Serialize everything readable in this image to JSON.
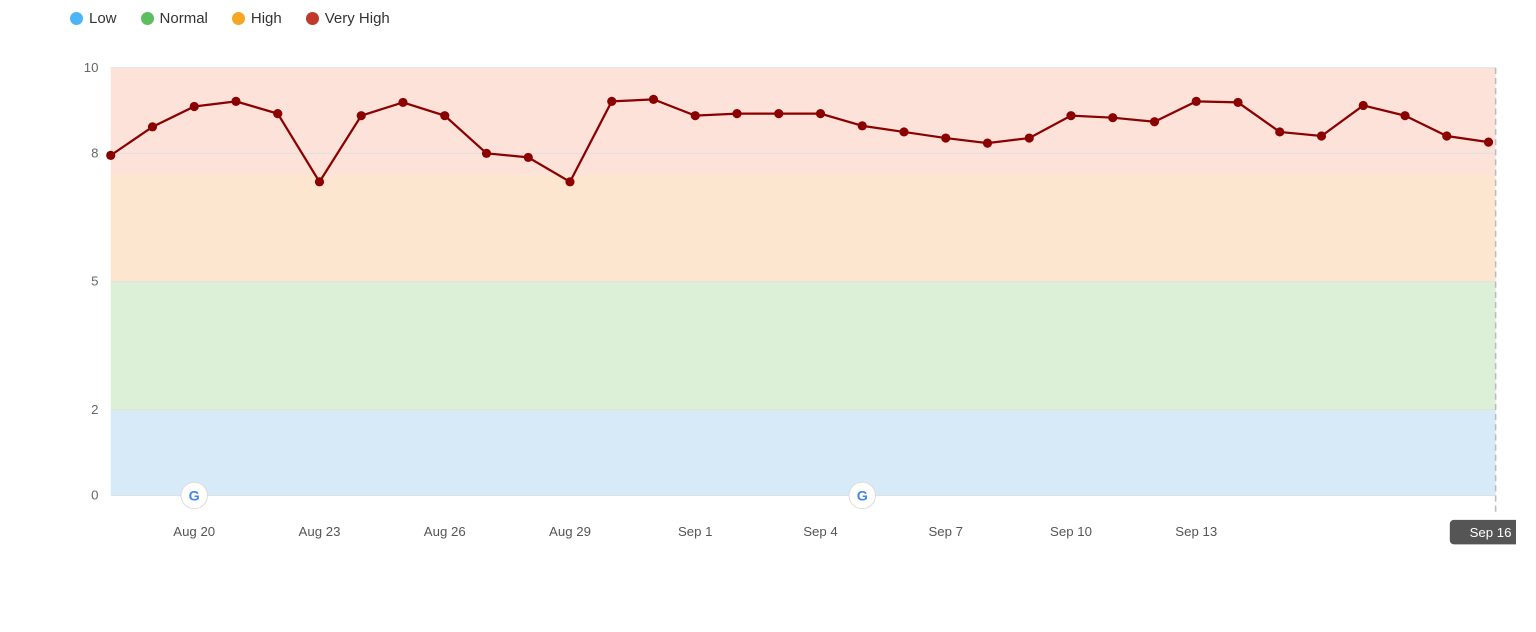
{
  "legend": {
    "items": [
      {
        "label": "Low",
        "color": "#4db5f7",
        "id": "low"
      },
      {
        "label": "Normal",
        "color": "#5bbf5f",
        "id": "normal"
      },
      {
        "label": "High",
        "color": "#f5a623",
        "id": "high"
      },
      {
        "label": "Very High",
        "color": "#c0392b",
        "id": "very-high"
      }
    ]
  },
  "chart": {
    "xLabels": [
      "Aug 20",
      "Aug 23",
      "Aug 26",
      "Aug 29",
      "Sep 1",
      "Sep 4",
      "Sep 7",
      "Sep 10",
      "Sep 13",
      "Sep 16"
    ],
    "yLabels": [
      "0",
      "2",
      "5",
      "8",
      "10"
    ],
    "bands": [
      {
        "label": "Low",
        "yMin": 0,
        "yMax": 2,
        "color": "rgba(173,214,241,0.45)"
      },
      {
        "label": "Normal",
        "yMin": 2,
        "yMax": 5,
        "color": "rgba(183,225,175,0.45)"
      },
      {
        "label": "High",
        "yMin": 5,
        "yMax": 7.5,
        "color": "rgba(248,200,150,0.35)"
      },
      {
        "label": "Very High",
        "yMin": 7.5,
        "yMax": 10,
        "color": "rgba(248,185,165,0.38)"
      }
    ],
    "dataPoints": [
      {
        "x": "Aug 18",
        "y": 7.85
      },
      {
        "x": "Aug 19",
        "y": 8.4
      },
      {
        "x": "Aug 20",
        "y": 9.1
      },
      {
        "x": "Aug 21",
        "y": 9.2
      },
      {
        "x": "Aug 22",
        "y": 8.9
      },
      {
        "x": "Aug 23",
        "y": 7.4
      },
      {
        "x": "Aug 24",
        "y": 8.85
      },
      {
        "x": "Aug 25",
        "y": 9.15
      },
      {
        "x": "Aug 26",
        "y": 8.85
      },
      {
        "x": "Aug 27",
        "y": 8.0
      },
      {
        "x": "Aug 28",
        "y": 7.95
      },
      {
        "x": "Aug 29",
        "y": 7.4
      },
      {
        "x": "Aug 30",
        "y": 9.2
      },
      {
        "x": "Aug 31",
        "y": 9.25
      },
      {
        "x": "Sep 1",
        "y": 8.85
      },
      {
        "x": "Sep 2",
        "y": 8.9
      },
      {
        "x": "Sep 3",
        "y": 8.9
      },
      {
        "x": "Sep 4",
        "y": 8.9
      },
      {
        "x": "Sep 5",
        "y": 8.6
      },
      {
        "x": "Sep 6",
        "y": 8.45
      },
      {
        "x": "Sep 7",
        "y": 8.3
      },
      {
        "x": "Sep 8",
        "y": 8.2
      },
      {
        "x": "Sep 9",
        "y": 8.35
      },
      {
        "x": "Sep 10",
        "y": 8.8
      },
      {
        "x": "Sep 11",
        "y": 8.75
      },
      {
        "x": "Sep 12",
        "y": 8.65
      },
      {
        "x": "Sep 13",
        "y": 9.2
      },
      {
        "x": "Sep 14",
        "y": 9.15
      },
      {
        "x": "Sep 15",
        "y": 8.45
      },
      {
        "x": "Sep 16",
        "y": 8.35
      },
      {
        "x": "Sep 17",
        "y": 9.1
      },
      {
        "x": "Sep 18",
        "y": 8.75
      },
      {
        "x": "Sep 19",
        "y": 8.3
      },
      {
        "x": "Sep 20",
        "y": 8.3
      }
    ],
    "googleEvents": [
      {
        "x": "Aug 20",
        "label": "G"
      },
      {
        "x": "Sep 4",
        "label": "G"
      }
    ],
    "lastLabelHighlighted": "Sep 16"
  }
}
